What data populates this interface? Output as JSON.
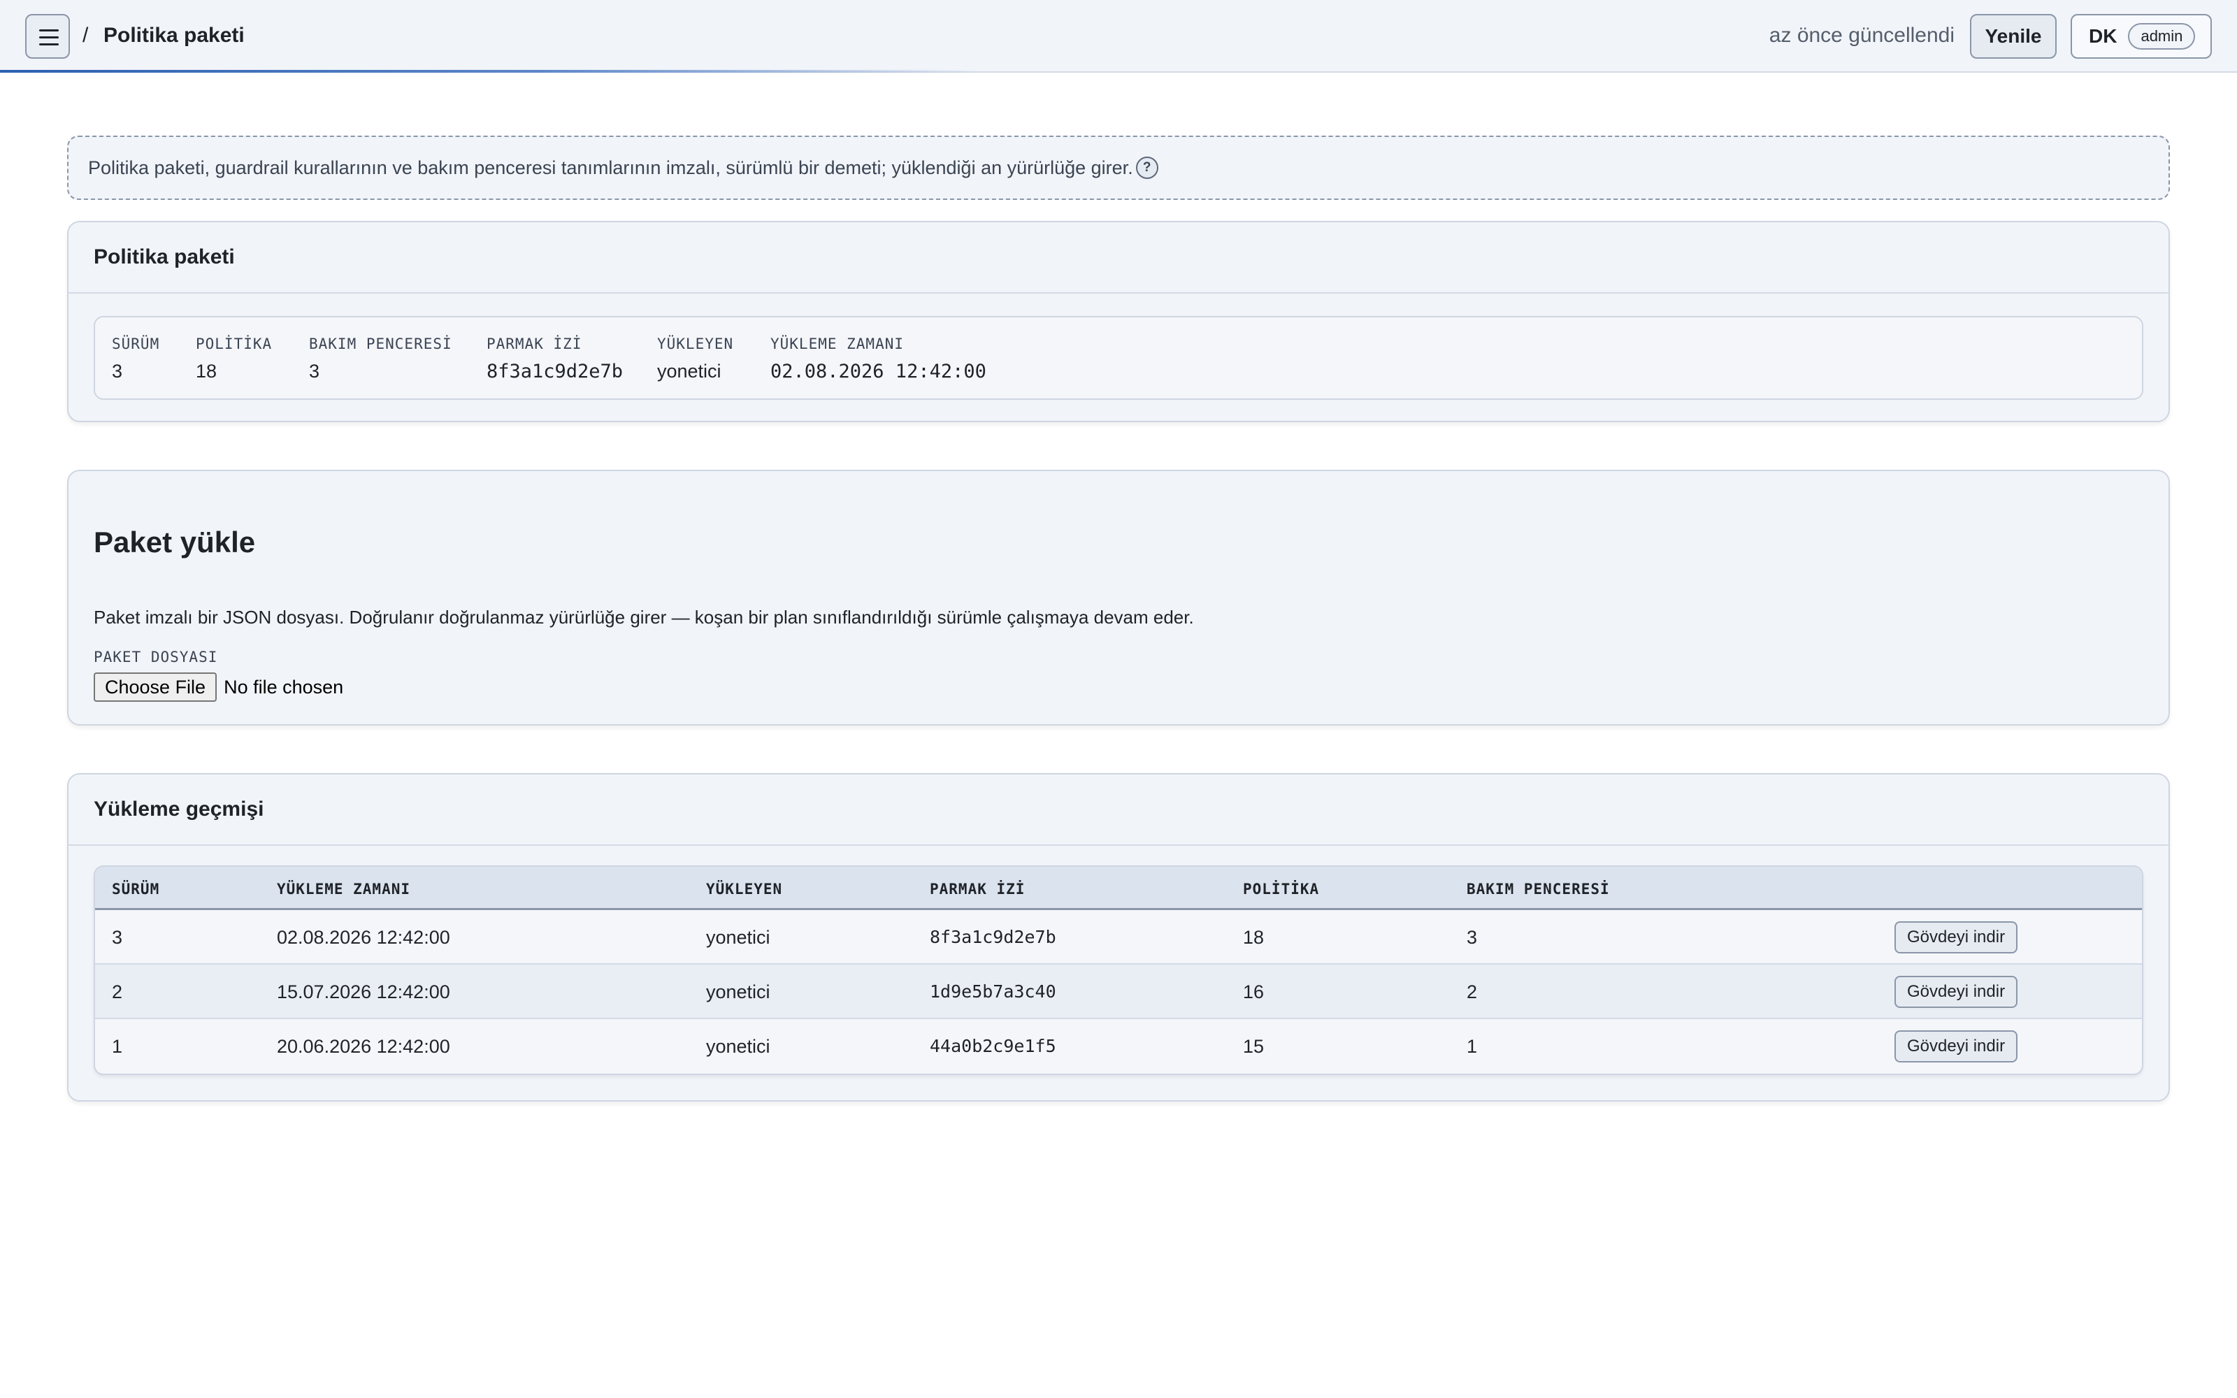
{
  "header": {
    "breadcrumb_sep": "/",
    "title": "Politika paketi",
    "updated_text": "az önce güncellendi",
    "refresh_label": "Yenile",
    "user_initials": "DK",
    "user_role": "admin"
  },
  "note": {
    "text": "Politika paketi, guardrail kurallarının ve bakım penceresi tanımlarının imzalı, sürümlü bir demeti; yüklendiği an yürürlüğe girer.",
    "help_glyph": "?"
  },
  "current_bundle": {
    "title": "Politika paketi",
    "fields": [
      {
        "label": "SÜRÜM",
        "value": "3"
      },
      {
        "label": "POLİTİKA",
        "value": "18"
      },
      {
        "label": "BAKIM PENCERESİ",
        "value": "3"
      },
      {
        "label": "PARMAK İZİ",
        "value": "8f3a1c9d2e7b"
      },
      {
        "label": "YÜKLEYEN",
        "value": "yonetici"
      },
      {
        "label": "YÜKLEME ZAMANI",
        "value": "02.08.2026 12:42:00"
      }
    ]
  },
  "upload": {
    "title": "Paket yükle",
    "description": "Paket imzalı bir JSON dosyası. Doğrulanır doğrulanmaz yürürlüğe girer — koşan bir plan sınıflandırıldığı sürümle çalışmaya devam eder.",
    "file_label": "PAKET DOSYASI",
    "choose_label": "Choose File",
    "no_file_text": "No file chosen"
  },
  "history": {
    "title": "Yükleme geçmişi",
    "columns": [
      "SÜRÜM",
      "YÜKLEME ZAMANI",
      "YÜKLEYEN",
      "PARMAK İZİ",
      "POLİTİKA",
      "BAKIM PENCERESİ"
    ],
    "download_label": "Gövdeyi indir",
    "rows": [
      {
        "version": "3",
        "time": "02.08.2026 12:42:00",
        "by": "yonetici",
        "fingerprint": "8f3a1c9d2e7b",
        "policies": "18",
        "windows": "3"
      },
      {
        "version": "2",
        "time": "15.07.2026 12:42:00",
        "by": "yonetici",
        "fingerprint": "1d9e5b7a3c40",
        "policies": "16",
        "windows": "2"
      },
      {
        "version": "1",
        "time": "20.06.2026 12:42:00",
        "by": "yonetici",
        "fingerprint": "44a0b2c9e1f5",
        "policies": "15",
        "windows": "1"
      }
    ]
  }
}
